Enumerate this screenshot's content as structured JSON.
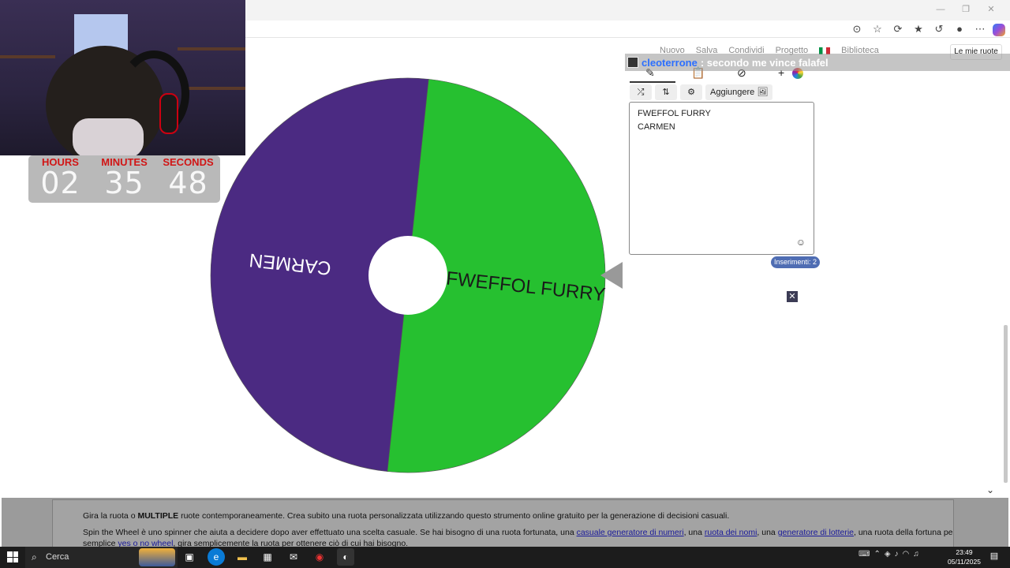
{
  "site_nav": {
    "items": [
      "Nuovo",
      "Salva",
      "Condividi",
      "Progetto",
      "",
      "Biblioteca"
    ],
    "my_wheels": "Le mie ruote"
  },
  "chat": {
    "user": "cleoterrone",
    "message": ": secondo me vince falafel"
  },
  "editor": {
    "add_image_label": "Aggiungere",
    "entries": [
      "FWEFFOL FURRY",
      "CARMEN"
    ],
    "count_label": "Inserimenti: 2",
    "close_symbol": "✕"
  },
  "wheel": {
    "segments": [
      {
        "label": "FWEFFOL FURRY",
        "color": "#26c030"
      },
      {
        "label": "CARMEN",
        "color": "#4b2a82"
      }
    ],
    "pointer_color": "#999999"
  },
  "timer": {
    "hours_label": "HOURS",
    "hours": "02",
    "minutes_label": "MINUTES",
    "minutes": "35",
    "seconds_label": "SECONDS",
    "seconds": "48"
  },
  "info": {
    "line1_a": "Gira la ruota o ",
    "line1_b": "MULTIPLE",
    "line1_c": " ruote contemporaneamente. Crea subito una ruota personalizzata utilizzando questo strumento online gratuito per la generazione di decisioni casuali.",
    "line2_a": "Spin the Wheel è uno spinner che aiuta a decidere dopo aver effettuato una scelta casuale. Se hai bisogno di una ruota fortunata, una ",
    "link1": "casuale generatore di numeri",
    "line2_b": ", una ",
    "link2": "ruota dei nomi",
    "line2_c": ", una ",
    "link3": "generatore di lotterie",
    "line2_d": ", una ruota della fortuna per i giochi o un",
    "line3_a": "semplice ",
    "link4": "yes o no wheel",
    "line3_b": ", gira semplicemente la ruota per ottenere ciò di cui hai bisogno."
  },
  "taskbar": {
    "search_placeholder": "Cerca",
    "time": "23:49",
    "date": "05/11/2025"
  }
}
